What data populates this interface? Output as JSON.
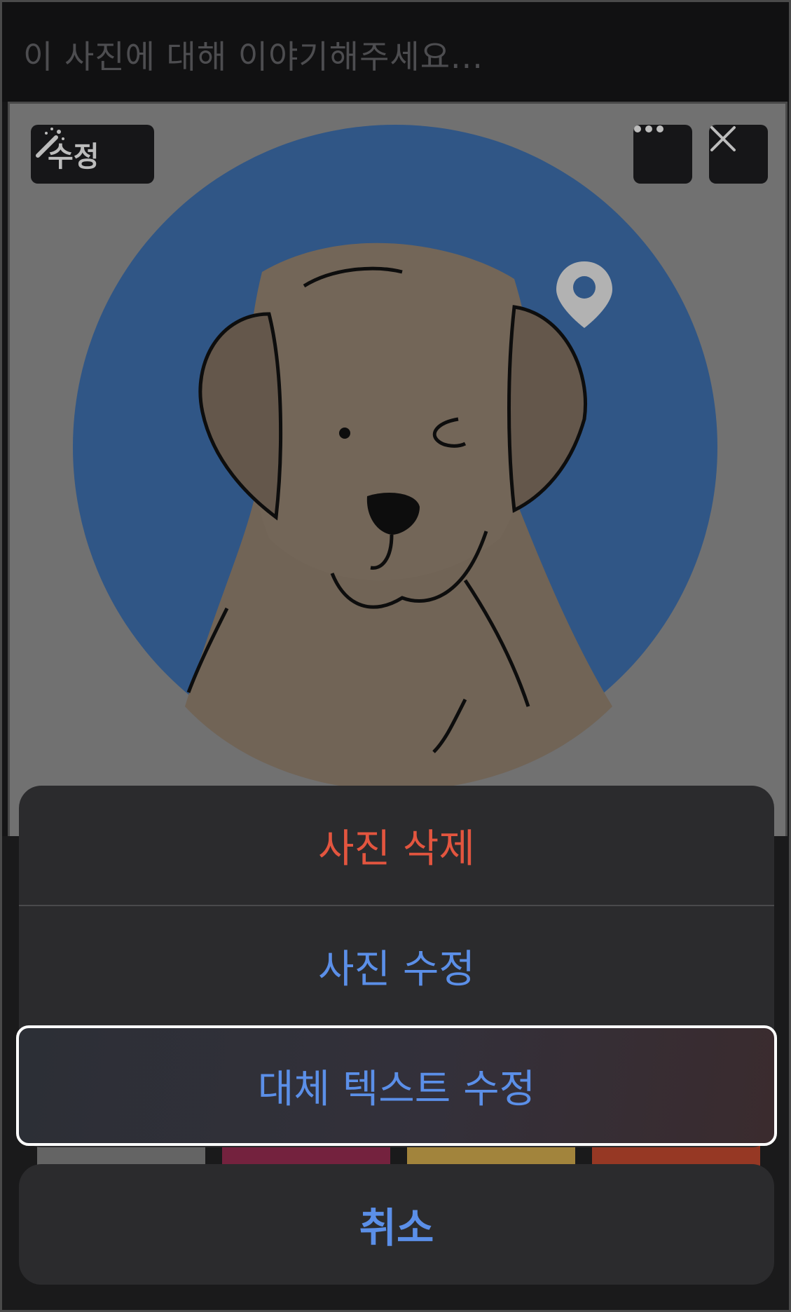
{
  "composer": {
    "placeholder": "이 사진에 대해 이야기해주세요..."
  },
  "photo": {
    "edit_chip_label": "수정",
    "icons": [
      "magic-wand-icon",
      "more-icon",
      "close-icon",
      "location-pin-icon"
    ],
    "colors": {
      "circle": "#3b6aa4",
      "dog": "#8a7a6a",
      "background": "#8a8a8a"
    }
  },
  "action_sheet": {
    "items": [
      {
        "label": "사진 삭제",
        "color": "#e3553f"
      },
      {
        "label": "사진 수정",
        "color": "#5b8fe8"
      },
      {
        "label": "대체 텍스트 수정",
        "color": "#5b8fe8"
      }
    ],
    "cancel_label": "취소"
  }
}
